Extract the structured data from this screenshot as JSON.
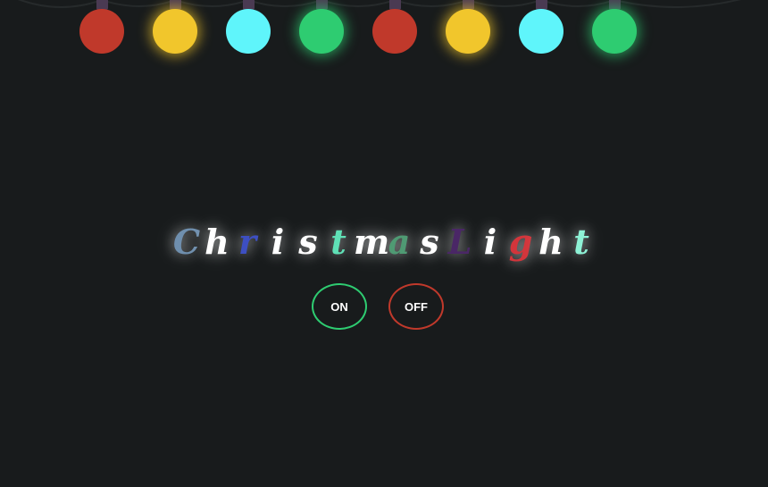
{
  "bulbs": [
    {
      "name": "bulb-1",
      "color": "#c0392b",
      "glow": false
    },
    {
      "name": "bulb-2",
      "color": "#f1c62c",
      "glow": true
    },
    {
      "name": "bulb-3",
      "color": "#5ff5fb",
      "glow": false
    },
    {
      "name": "bulb-4",
      "color": "#2ecc71",
      "glow": true
    },
    {
      "name": "bulb-5",
      "color": "#c0392b",
      "glow": false
    },
    {
      "name": "bulb-6",
      "color": "#f1c62c",
      "glow": true
    },
    {
      "name": "bulb-7",
      "color": "#5ff5fb",
      "glow": false
    },
    {
      "name": "bulb-8",
      "color": "#2ecc71",
      "glow": true
    }
  ],
  "title": {
    "letters": [
      {
        "char": "C",
        "color": "#6f8fae"
      },
      {
        "char": "h",
        "color": "#ffffff"
      },
      {
        "char": "r",
        "color": "#3d4fc2"
      },
      {
        "char": "i",
        "color": "#ffffff"
      },
      {
        "char": "s",
        "color": "#ffffff"
      },
      {
        "char": "t",
        "color": "#5fe0b6"
      },
      {
        "char": "m",
        "color": "#ffffff"
      },
      {
        "char": "a",
        "color": "#4f9a73"
      },
      {
        "char": "s",
        "color": "#ffffff"
      },
      {
        "char": "L",
        "color": "#4a2766"
      },
      {
        "char": "i",
        "color": "#ffffff"
      },
      {
        "char": "g",
        "color": "#d3353b"
      },
      {
        "char": "h",
        "color": "#ffffff"
      },
      {
        "char": "t",
        "color": "#8ef2d6"
      }
    ]
  },
  "controls": {
    "on_label": "ON",
    "off_label": "OFF",
    "on_color": "#2ecc71",
    "off_color": "#c0392b"
  }
}
